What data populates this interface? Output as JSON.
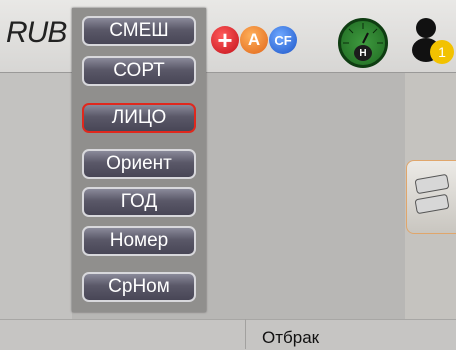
{
  "header": {
    "currency": "RUB",
    "icons": [
      "plus-icon",
      "a-icon",
      "cf-icon",
      "gauge-icon",
      "user-icon"
    ],
    "icon_labels": {
      "plus": "+",
      "a": "A",
      "cf": "CF",
      "gauge": "H",
      "user_badge": "1"
    }
  },
  "menu": {
    "items": [
      {
        "label": "СМЕШ"
      },
      {
        "label": "СОРТ"
      },
      {
        "label": "ЛИЦО"
      },
      {
        "label": "Ориент"
      },
      {
        "label": "ГОД"
      },
      {
        "label": "Номер"
      },
      {
        "label": "СрНом"
      }
    ],
    "selected": "ЛИЦО"
  },
  "footer": {
    "status": "Отбрак"
  },
  "colors": {
    "accent_selected": "#e0281d",
    "plus_icon": "#c3121b",
    "a_icon": "#e0661a",
    "cf_icon": "#1e56c8",
    "gauge": "#2f8a31"
  }
}
